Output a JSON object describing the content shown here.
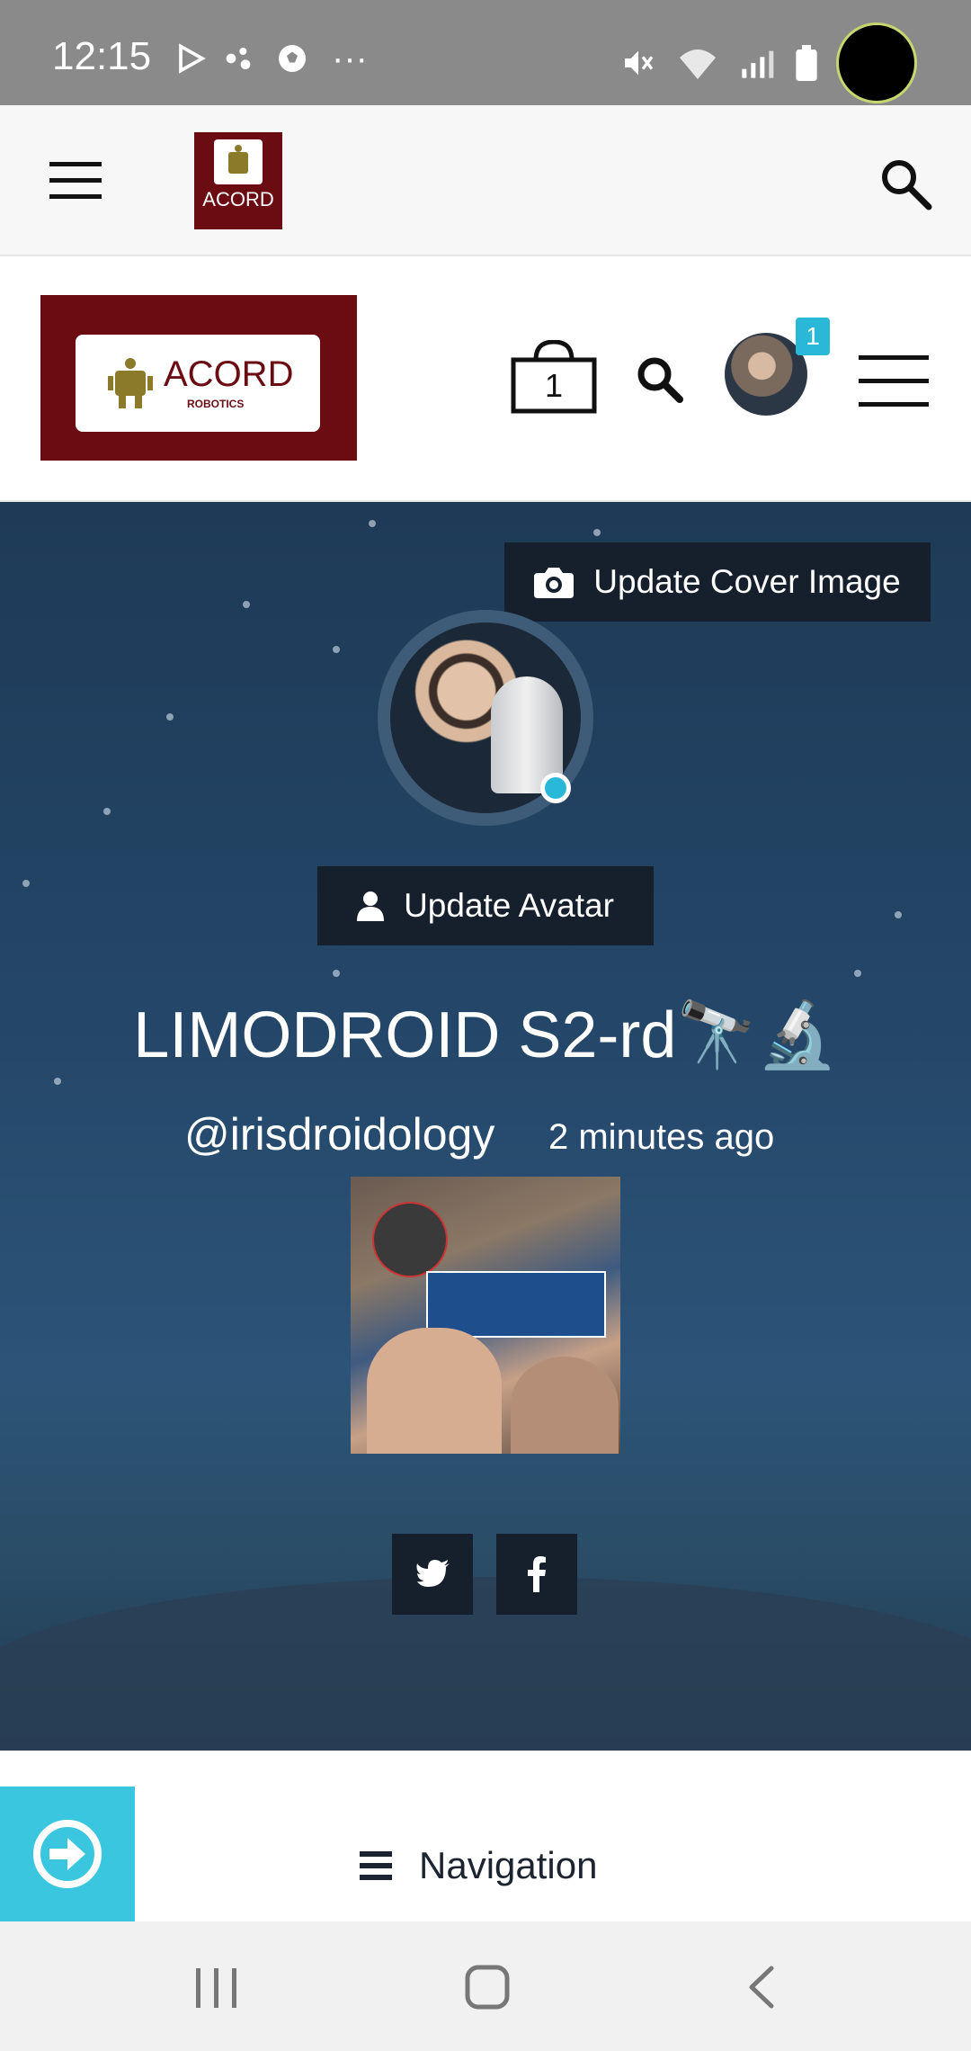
{
  "status_bar": {
    "time": "12:15"
  },
  "header": {
    "logo_small_text": "ACORD",
    "logo_big_text": "ACORD",
    "logo_big_subtext": "ROBOTICS",
    "cart_count": "1",
    "notification_count": "1"
  },
  "cover": {
    "update_cover_label": "Update Cover Image",
    "update_avatar_label": "Update Avatar"
  },
  "profile": {
    "name": "LIMODROID S2-rd🔭🔬",
    "handle": "@irisdroidology",
    "last_active": "2 minutes ago"
  },
  "navigation": {
    "label": "Navigation"
  },
  "colors": {
    "brand_maroon": "#6b0b12",
    "accent_cyan": "#29b8d8",
    "dark_button": "#15202c"
  }
}
